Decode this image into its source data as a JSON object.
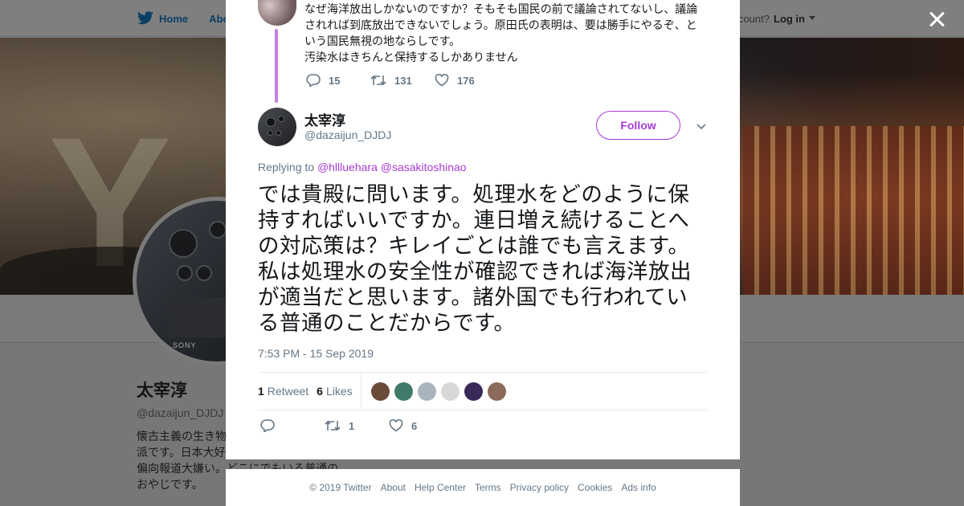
{
  "colors": {
    "accent": "#a63cd1",
    "thread_line": "#c47ee1",
    "muted": "#657786",
    "text": "#14171a"
  },
  "background_page": {
    "nav": [
      {
        "label": "Home",
        "icon": "twitter-bird-icon"
      },
      {
        "label": "Abo"
      }
    ],
    "account_prompt": "ccount?",
    "login_label": "Log in",
    "profile": {
      "name": "太宰淳",
      "handle": "@dazaijun_DJDJ",
      "bio_lines": [
        "懐古主義の生き物",
        "派です。日本大好",
        "偏向報道大嫌い。どこにでもいる普通の",
        "おやじです。"
      ],
      "avatar_brand": "SONY"
    }
  },
  "modal": {
    "close_icon": "close-icon",
    "previous_tweet": {
      "text_lines": [
        "なぜ海洋放出しかないのですか？そもそも国民の前で議論されてないし、議論",
        "されれば到底放出できないでしょう。原田氏の表明は、要は勝手にやるぞ、と",
        "いう国民無視の地ならしです。",
        "汚染水はきちんと保持するしかありません"
      ],
      "replies": "15",
      "retweets": "131",
      "likes": "176"
    },
    "tweet": {
      "name": "太宰淳",
      "handle": "@dazaijun_DJDJ",
      "follow_label": "Follow",
      "replying_prefix": "Replying to",
      "replying_to": [
        "@hllluehara",
        "@sasakitoshinao"
      ],
      "text_lines": [
        "では貴殿に問います。処理水をどのように保",
        "持すればいいですか。連日増え続けることへ",
        "の対応策は？キレイごとは誰でも言えます。",
        "私は処理水の安全性が確認できれば海洋放出",
        "が適当だと思います。諸外国でも行われてい",
        "る普通のことだからです。"
      ],
      "timestamp": "7:53 PM - 15 Sep 2019",
      "retweet_count": "1",
      "retweet_label": "Retweet",
      "like_count": "6",
      "like_label": "Likes",
      "liker_colors": [
        "#6b4a3a",
        "#3f7a6a",
        "#aab4be",
        "#d8d8d8",
        "#3a2a5a",
        "#8a6a5a"
      ],
      "actions": {
        "replies": "",
        "retweets": "1",
        "likes": "6"
      }
    }
  },
  "footer": {
    "links": [
      "© 2019 Twitter",
      "About",
      "Help Center",
      "Terms",
      "Privacy policy",
      "Cookies",
      "Ads info"
    ]
  }
}
